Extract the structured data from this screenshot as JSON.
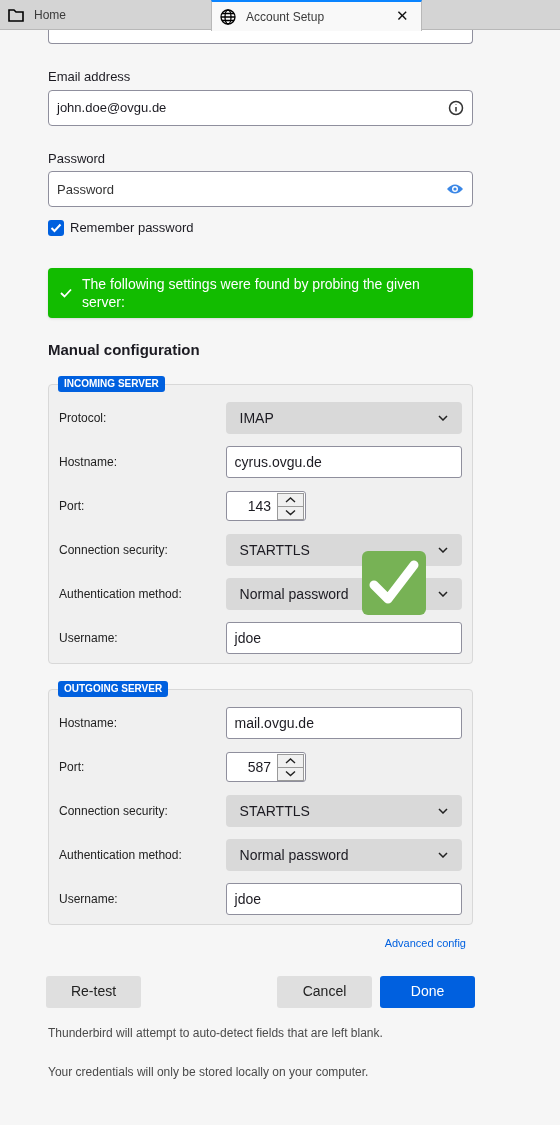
{
  "tabs": [
    {
      "label": "Home",
      "selected": false
    },
    {
      "label": "Account Setup",
      "selected": true,
      "close": "✕"
    }
  ],
  "email": {
    "label": "Email address",
    "value": "john.doe@ovgu.de"
  },
  "password": {
    "label": "Password",
    "placeholder": "Password"
  },
  "remember": {
    "label": "Remember password",
    "checked": true
  },
  "banner": {
    "text": "The following settings were found by probing the given server:"
  },
  "manual_heading": "Manual configuration",
  "servers": [
    {
      "legend": "INCOMING SERVER",
      "rows": [
        {
          "kind": "select",
          "label": "Protocol:",
          "value": "IMAP"
        },
        {
          "kind": "text",
          "label": "Hostname:",
          "value": "cyrus.ovgu.de"
        },
        {
          "kind": "number",
          "label": "Port:",
          "value": "143"
        },
        {
          "kind": "select",
          "label": "Connection security:",
          "value": "STARTTLS"
        },
        {
          "kind": "select",
          "label": "Authentication method:",
          "value": "Normal password"
        },
        {
          "kind": "text",
          "label": "Username:",
          "value": "jdoe"
        }
      ]
    },
    {
      "legend": "OUTGOING SERVER",
      "rows": [
        {
          "kind": "text",
          "label": "Hostname:",
          "value": "mail.ovgu.de"
        },
        {
          "kind": "number",
          "label": "Port:",
          "value": "587"
        },
        {
          "kind": "select",
          "label": "Connection security:",
          "value": "STARTTLS"
        },
        {
          "kind": "select",
          "label": "Authentication method:",
          "value": "Normal password"
        },
        {
          "kind": "text",
          "label": "Username:",
          "value": "jdoe"
        }
      ]
    }
  ],
  "advanced_link": "Advanced config",
  "left_buttons": [
    {
      "label": "Re-test",
      "kind": "secondary"
    }
  ],
  "right_buttons": [
    {
      "label": "Cancel",
      "kind": "secondary"
    },
    {
      "label": "Done",
      "kind": "primary"
    }
  ],
  "notes": [
    "Thunderbird will attempt to auto-detect fields that are left blank.",
    "Your credentials will only be stored locally on your computer."
  ]
}
